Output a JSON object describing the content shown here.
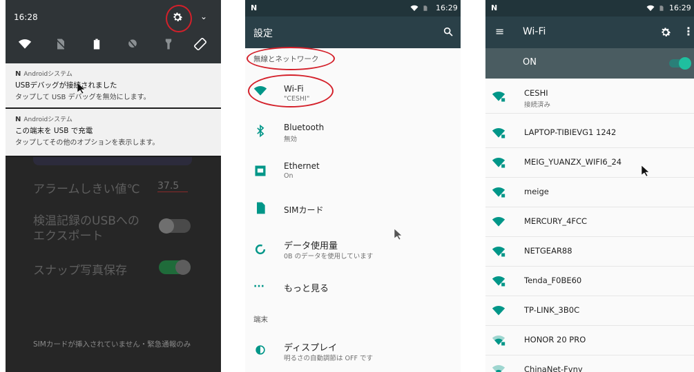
{
  "panel1": {
    "time": "16:28",
    "notifications": [
      {
        "app": "Androidシステム",
        "title": "USBデバッグが接続されました",
        "text": "タップして USB デバッグを無効にします。"
      },
      {
        "app": "Androidシステム",
        "title": "この端末を USB で充電",
        "text": "タップしてその他のオプションを表示します。"
      }
    ],
    "alarm_label": "アラームしきい値℃",
    "alarm_value": "37.5",
    "usb_export_label_1": "検温記録のUSBへの",
    "usb_export_label_2": "エクスポート",
    "snapshot_label": "スナップ写真保存",
    "sim_status": "SIMカードが挿入されていません・緊急通報のみ"
  },
  "panel2": {
    "time": "16:29",
    "title": "設定",
    "section_wireless": "無線とネットワーク",
    "items": [
      {
        "label": "Wi-Fi",
        "sub": "\"CESHI\""
      },
      {
        "label": "Bluetooth",
        "sub": "無効"
      },
      {
        "label": "Ethernet",
        "sub": "On"
      },
      {
        "label": "SIMカード",
        "sub": ""
      },
      {
        "label": "データ使用量",
        "sub": "0B のデータを使用しています"
      },
      {
        "label": "もっと見る",
        "sub": ""
      }
    ],
    "section_device": "端末",
    "display_label": "ディスプレイ",
    "display_sub": "明るさの自動調節は OFF です"
  },
  "panel3": {
    "time": "16:29",
    "title": "Wi-Fi",
    "state": "ON",
    "networks": [
      {
        "ssid": "CESHI",
        "sub": "接続済み"
      },
      {
        "ssid": "LAPTOP-TIBIEVG1 1242",
        "sub": ""
      },
      {
        "ssid": "MEIG_YUANZX_WIFI6_24",
        "sub": ""
      },
      {
        "ssid": "meige",
        "sub": ""
      },
      {
        "ssid": "MERCURY_4FCC",
        "sub": ""
      },
      {
        "ssid": "NETGEAR88",
        "sub": ""
      },
      {
        "ssid": "Tenda_F0BE60",
        "sub": ""
      },
      {
        "ssid": "TP-LINK_3B0C",
        "sub": ""
      },
      {
        "ssid": "HONOR 20 PRO",
        "sub": ""
      },
      {
        "ssid": "ChinaNet-Fvny",
        "sub": ""
      }
    ]
  },
  "colors": {
    "accent": "#009688",
    "highlight": "#d4202a"
  }
}
